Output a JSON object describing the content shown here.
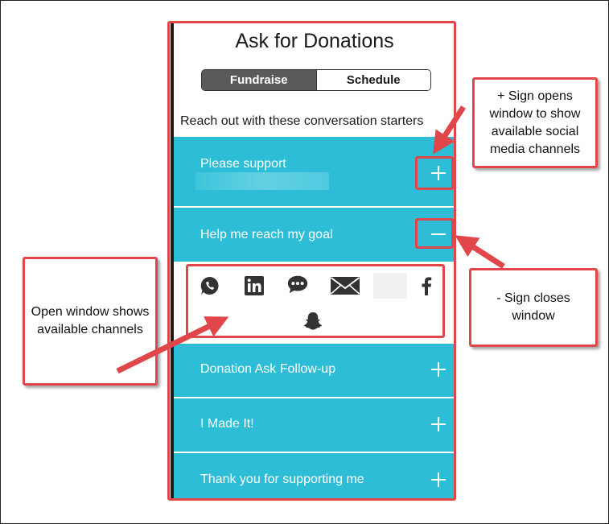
{
  "app": {
    "title": "Ask for Donations",
    "tabs": [
      {
        "label": "Fundraise",
        "active": true
      },
      {
        "label": "Schedule",
        "active": false
      }
    ],
    "intro": "Reach out with these conversation starters",
    "rows": [
      {
        "label": "Please support",
        "state": "collapsed"
      },
      {
        "label": "Help me reach my goal",
        "state": "expanded"
      },
      {
        "label": "Donation Ask Follow-up",
        "state": "collapsed"
      },
      {
        "label": "I Made It!",
        "state": "collapsed"
      },
      {
        "label": "Thank you for supporting me",
        "state": "collapsed"
      }
    ],
    "channels": [
      "whatsapp-icon",
      "linkedin-icon",
      "sms-icon",
      "email-icon",
      "blank-channel",
      "facebook-icon",
      "snapchat-icon"
    ]
  },
  "annotations": {
    "plus_note": "+ Sign opens window to show available social media channels",
    "minus_note": "- Sign closes window",
    "window_note": "Open window shows available channels"
  },
  "colors": {
    "row_bg": "#2ebdd6",
    "annotation": "#e0464a",
    "active_tab": "#5a5a5a"
  }
}
